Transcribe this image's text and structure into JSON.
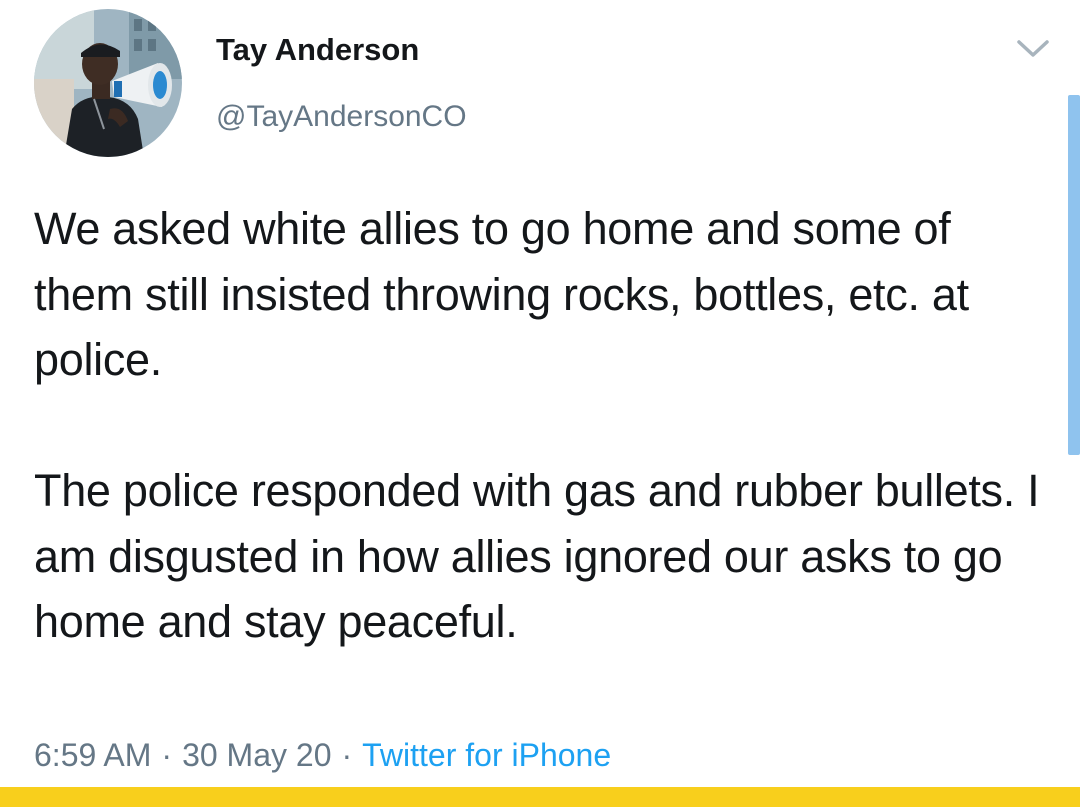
{
  "author": {
    "display_name": "Tay Anderson",
    "handle": "@TayAndersonCO",
    "avatar_icon": "profile-photo-megaphone"
  },
  "tweet": {
    "paragraphs": [
      "We asked white allies to go home and some of them still insisted throwing rocks, bottles, etc. at police.",
      "The police responded with gas and rubber bullets. I am disgusted in how allies ignored our asks to go home and stay peaceful."
    ],
    "time": "6:59 AM",
    "date": "30 May 20",
    "separator": "·",
    "source": "Twitter for iPhone"
  },
  "icons": {
    "menu": "chevron-down-icon"
  },
  "colors": {
    "primary_text": "#14171a",
    "secondary_text": "#657786",
    "link": "#1da1f2",
    "bottom_band": "#f8cf1c",
    "scrollbar": "#8fc3ee"
  }
}
